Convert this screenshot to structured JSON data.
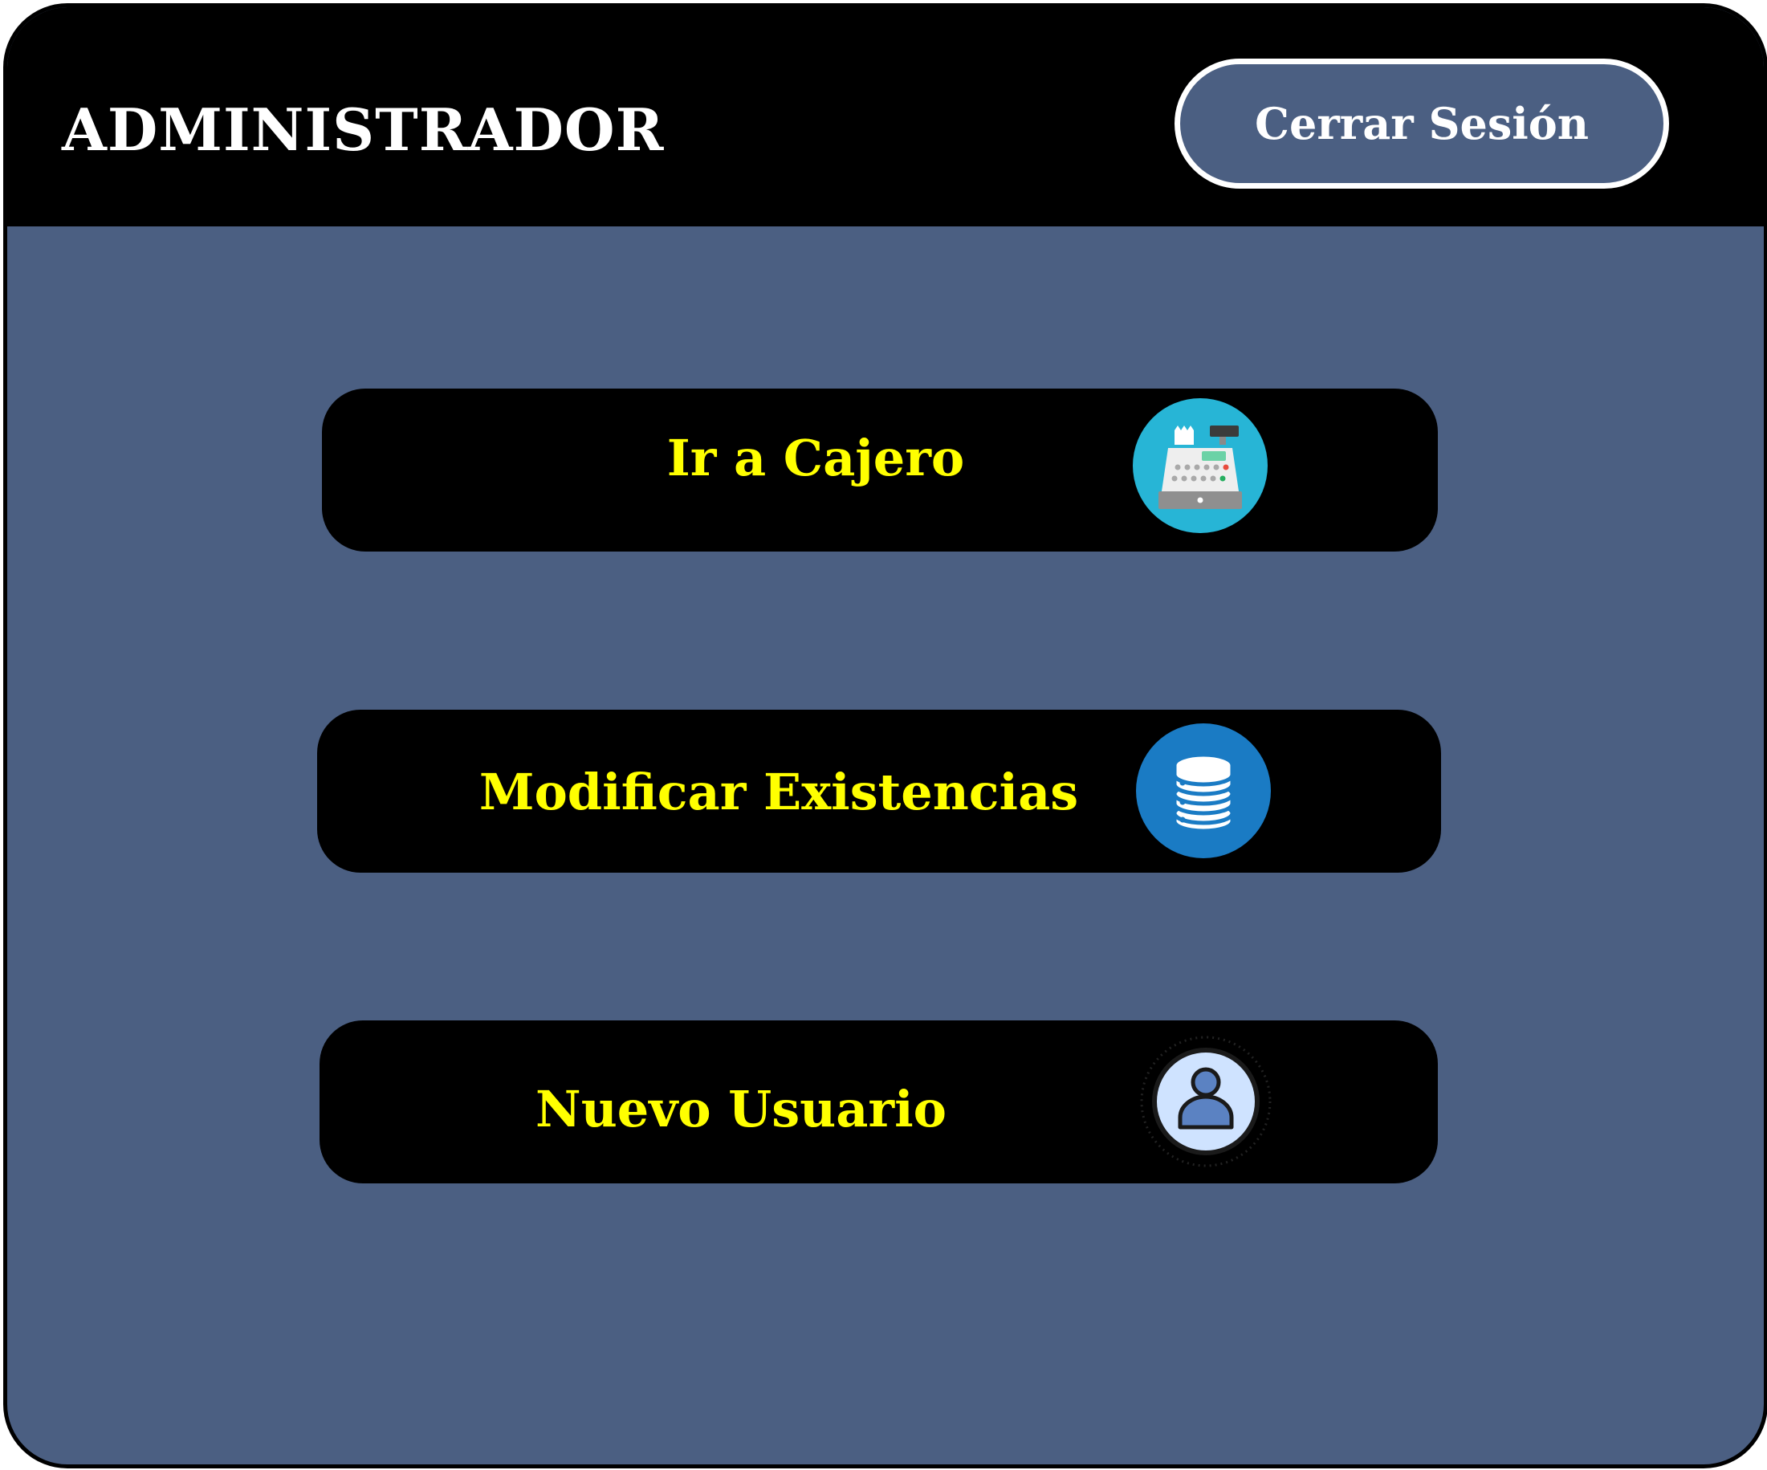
{
  "header": {
    "title": "ADMINISTRADOR",
    "logout_label": "Cerrar Sesión"
  },
  "actions": [
    {
      "label": "Ir a Cajero",
      "icon": "cash-register-icon"
    },
    {
      "label": "Modificar Existencias",
      "icon": "database-icon"
    },
    {
      "label": "Nuevo Usuario",
      "icon": "user-icon"
    }
  ],
  "colors": {
    "background": "#4b5f82",
    "header": "#000000",
    "button": "#000000",
    "button_text": "#ffff00",
    "header_text": "#ffffff"
  }
}
